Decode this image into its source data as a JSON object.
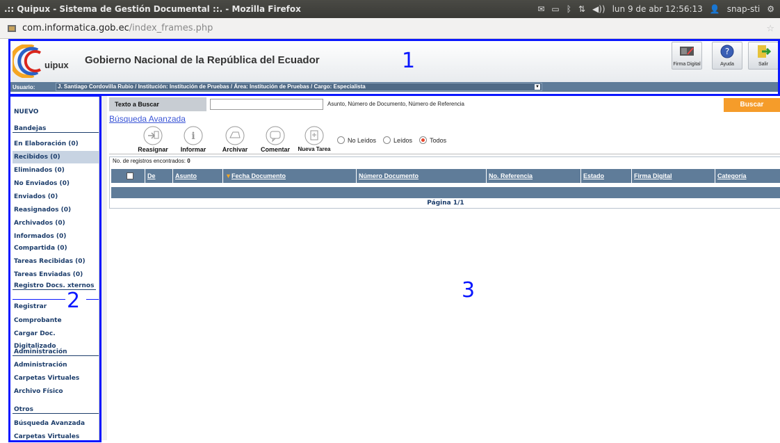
{
  "os": {
    "window_title": ".:: Quipux - Sistema de Gestión Documental ::. - Mozilla Firefox",
    "clock": "lun 9 de abr 12:56:13",
    "user": "snap-sti"
  },
  "browser": {
    "url_domain": "com.informatica.gob.ec",
    "url_path": "/index_frames.php"
  },
  "header": {
    "logo_text": "uipux",
    "org_title": "Gobierno Nacional de la República del Ecuador",
    "buttons": [
      {
        "label": "Firma Digital",
        "icon": "signature-icon"
      },
      {
        "label": "Ayuda",
        "icon": "help-icon"
      },
      {
        "label": "Salir",
        "icon": "exit-icon"
      }
    ]
  },
  "userbar": {
    "label": "Usuario:",
    "value": "J. Santiago Cordovilla Rubio / Institución: Institución de Pruebas / Área: Institución de Pruebas / Cargo: Especialista"
  },
  "sidebar": {
    "nuevo": "NUEVO",
    "bandejas_title": "Bandejas",
    "bandejas": [
      "En Elaboración (0)",
      "Recibidos (0)",
      "Eliminados (0)",
      "No Enviados (0)",
      "Enviados (0)",
      "Reasignados (0)",
      "Archivados (0)",
      "Informados (0)",
      "Compartida (0)",
      "Tareas Recibidas (0)",
      "Tareas Enviadas (0)"
    ],
    "registro_title": "Registro Docs. xternos",
    "registro": [
      "Registrar",
      "Comprobante",
      "Cargar Doc. Digitalizado"
    ],
    "admin_title": "Administración",
    "admin": [
      "Administración",
      "Carpetas Virtuales",
      "Archivo Físico"
    ],
    "otros_title": "Otros",
    "otros": [
      "Búsqueda Avanzada",
      "Carpetas Virtuales"
    ]
  },
  "search": {
    "label": "Texto a Buscar",
    "value": "",
    "hint": "Asunto, Número de Documento, Número de Referencia",
    "button": "Buscar",
    "advanced": "Búsqueda Avanzada"
  },
  "actions": [
    "Reasignar",
    "Informar",
    "Archivar",
    "Comentar",
    "Nueva Tarea"
  ],
  "filters": {
    "options": [
      "No Leídos",
      "Leídos",
      "Todos"
    ],
    "selected": "Todos"
  },
  "results": {
    "count_label": "No. de registros encontrados:",
    "count_value": "0",
    "columns": [
      "De",
      "Asunto",
      "Fecha Documento",
      "Número Documento",
      "No. Referencia",
      "Estado",
      "Firma Digital",
      "Categoría"
    ],
    "pagination": "Página 1/1"
  },
  "annotations": [
    "1",
    "2",
    "3"
  ],
  "colors": {
    "highlight": "#0a17ff",
    "table_header": "#5f7c99",
    "buscar_button": "#f59c2a",
    "sidebar_text": "#1c3d6b"
  }
}
